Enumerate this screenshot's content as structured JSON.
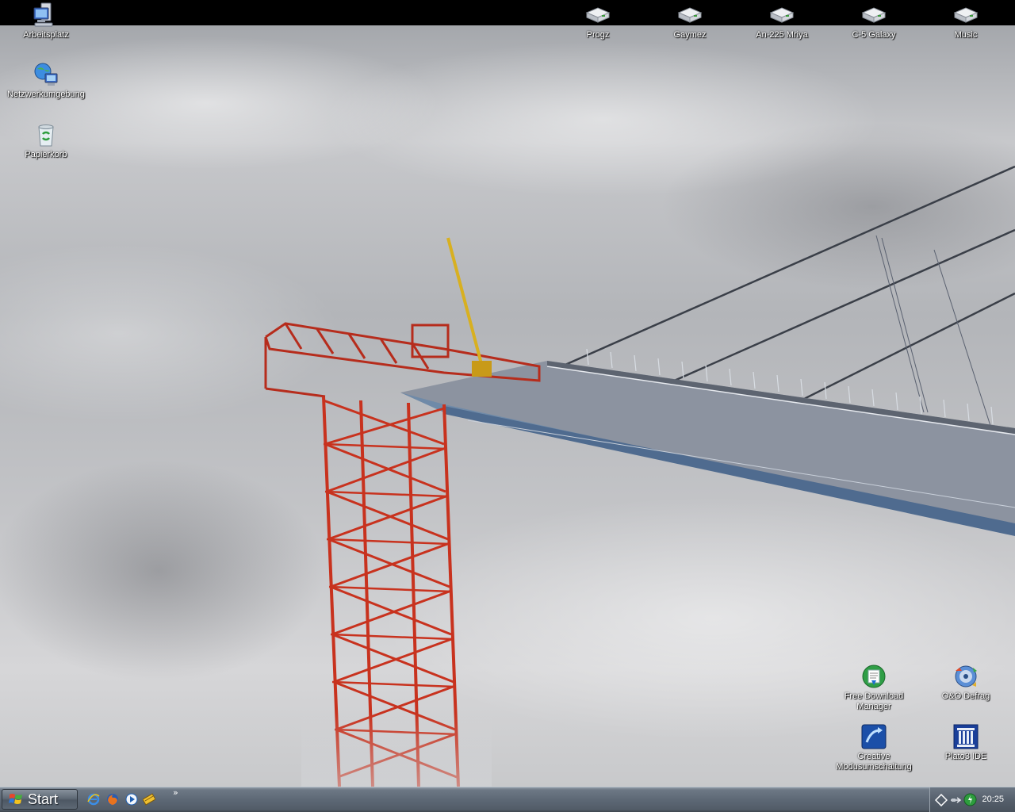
{
  "desktop": {
    "icons_left": [
      {
        "label": "Arbeitsplatz",
        "icon": "my-computer-icon"
      },
      {
        "label": "Netzwerkumgebung",
        "icon": "network-places-icon"
      },
      {
        "label": "Papierkorb",
        "icon": "recycle-bin-icon"
      }
    ],
    "icons_top": [
      {
        "label": "Progz",
        "icon": "drive-icon"
      },
      {
        "label": "Gaymez",
        "icon": "drive-icon"
      },
      {
        "label": "An-225 Mriya",
        "icon": "drive-icon"
      },
      {
        "label": "C-5 Galaxy",
        "icon": "drive-icon"
      },
      {
        "label": "Music",
        "icon": "drive-icon"
      }
    ],
    "icons_bottom_right": [
      {
        "line1": "Free Download",
        "line2": "Manager",
        "icon": "download-manager-icon"
      },
      {
        "line1": "O&O Defrag",
        "line2": "",
        "icon": "defrag-icon"
      },
      {
        "line1": "Creative",
        "line2": "Modusumschaltung",
        "icon": "creative-mode-icon"
      },
      {
        "line1": "Plato3 IDE",
        "line2": "",
        "icon": "plato-ide-icon"
      }
    ]
  },
  "taskbar": {
    "start_label": "Start",
    "quicklaunch": [
      "ie-icon",
      "firefox-icon",
      "media-player-icon",
      "app-icon"
    ],
    "overflow_label": "»",
    "clock": "20:25",
    "tray_icons": [
      "network-icon",
      "usb-icon",
      "power-icon"
    ]
  },
  "colors": {
    "taskbar": "#5d6875",
    "crane_red": "#c8321e",
    "bridge_deck": "#8e96a6"
  }
}
